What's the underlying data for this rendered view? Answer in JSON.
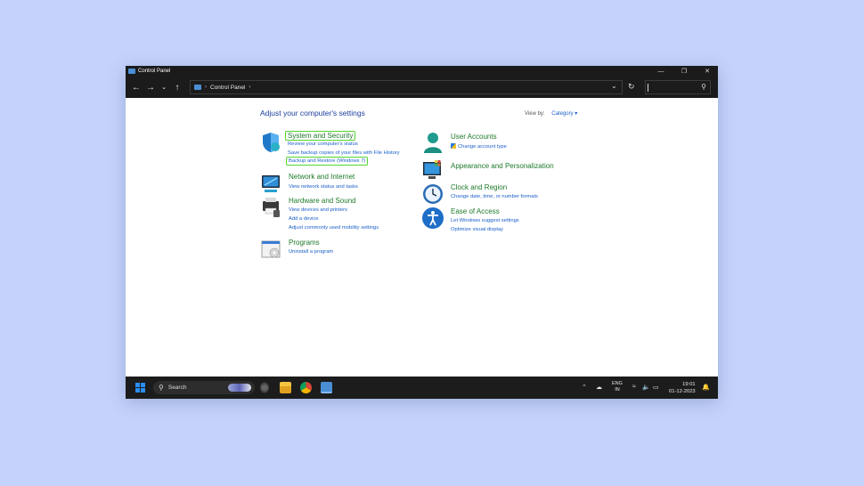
{
  "window": {
    "title": "Control Panel"
  },
  "address": {
    "breadcrumb": "Control Panel"
  },
  "content": {
    "heading": "Adjust your computer's settings",
    "view_by_label": "View by:",
    "view_by_value": "Category"
  },
  "categories_left": [
    {
      "title": "System and Security",
      "links": [
        "Review your computer's status",
        "Save backup copies of your files with File History",
        "Backup and Restore (Windows 7)"
      ]
    },
    {
      "title": "Network and Internet",
      "links": [
        "View network status and tasks"
      ]
    },
    {
      "title": "Hardware and Sound",
      "links": [
        "View devices and printers",
        "Add a device",
        "Adjust commonly used mobility settings"
      ]
    },
    {
      "title": "Programs",
      "links": [
        "Uninstall a program"
      ]
    }
  ],
  "categories_right": [
    {
      "title": "User Accounts",
      "links": [
        "Change account type"
      ]
    },
    {
      "title": "Appearance and Personalization",
      "links": []
    },
    {
      "title": "Clock and Region",
      "links": [
        "Change date, time, or number formats"
      ]
    },
    {
      "title": "Ease of Access",
      "links": [
        "Let Windows suggest settings",
        "Optimize visual display"
      ]
    }
  ],
  "taskbar": {
    "search_label": "Search",
    "lang_line1": "ENG",
    "lang_line2": "IN",
    "time": "19:01",
    "date": "01-12-2023"
  },
  "colors": {
    "link": "#1a5fc9",
    "category_title": "#1e7a2a",
    "heading": "#1a3e9d",
    "highlight": "#53d62c",
    "desktop_bg": "#c5d3fb"
  }
}
